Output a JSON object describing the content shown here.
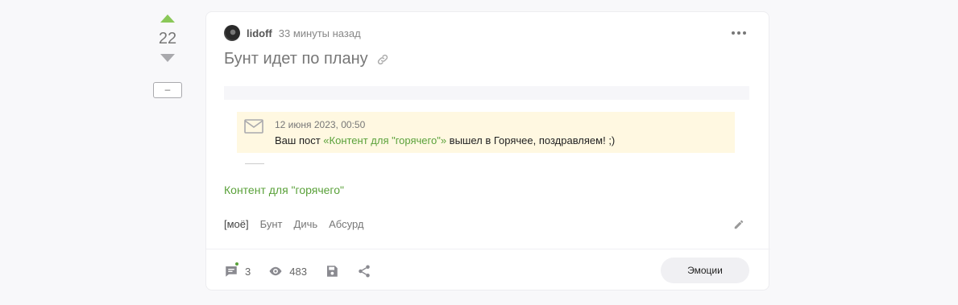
{
  "vote": {
    "count": "22",
    "collapse_label": "–"
  },
  "post": {
    "author": "lidoff",
    "time": "33 минуты назад",
    "title": "Бунт идет по плану",
    "notice": {
      "date": "12 июня 2023, 00:50",
      "text_before": "Ваш пост ",
      "link": "«Контент для \"горячего\"»",
      "text_after": " вышел в Горячее, поздравляем! ;)"
    },
    "link_text": "Контент для \"горячего\"",
    "tags": [
      "[моё]",
      "Бунт",
      "Дичь",
      "Абсурд"
    ]
  },
  "footer": {
    "comments": "3",
    "views": "483",
    "emotions_label": "Эмоции"
  },
  "colors": {
    "accent": "#5aa13a",
    "vote_up": "#8ac858",
    "notice_bg": "#fff8e1"
  }
}
